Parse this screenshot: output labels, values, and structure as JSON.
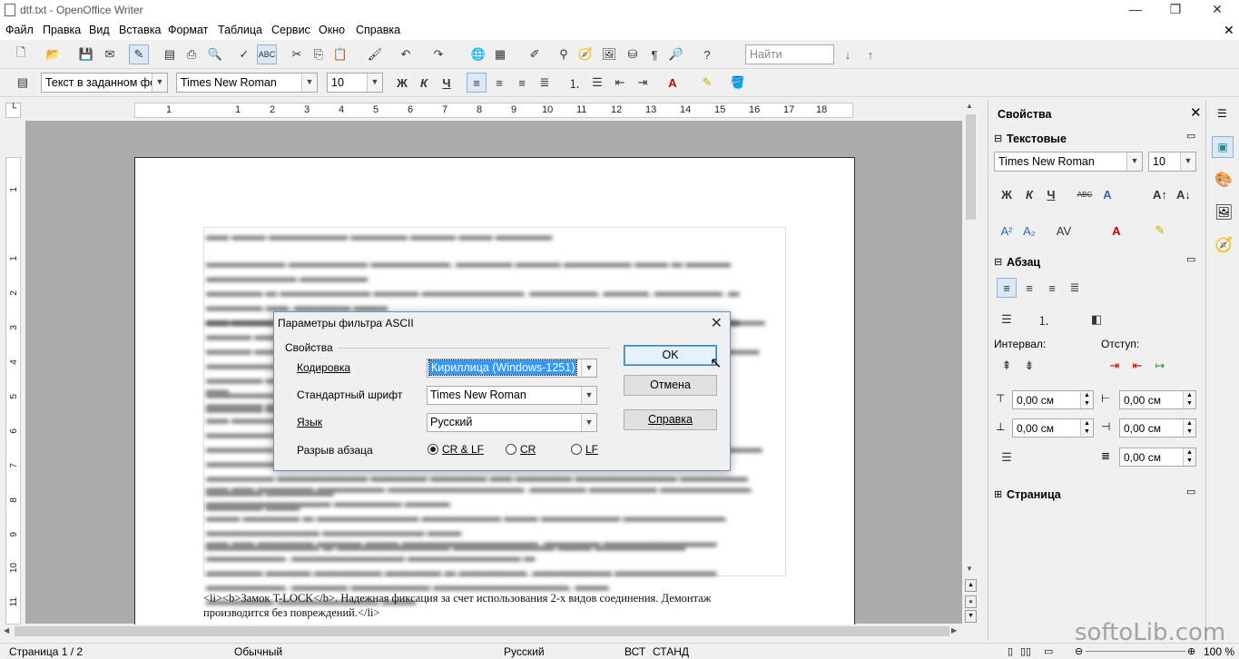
{
  "window": {
    "title": "dtf.txt - OpenOffice Writer",
    "min": "—",
    "restore": "❐",
    "close": "✕"
  },
  "menu": [
    "Файл",
    "Правка",
    "Вид",
    "Вставка",
    "Формат",
    "Таблица",
    "Сервис",
    "Окно",
    "Справка"
  ],
  "menu_close": "✕",
  "toolbar1": {
    "find_placeholder": "Найти"
  },
  "toolbar2": {
    "style": "Текст в заданном фор",
    "font": "Times New Roman",
    "size": "10",
    "bold": "Ж",
    "italic": "К",
    "underline": "Ч"
  },
  "ruler": {
    "h_ticks": [
      "1",
      "1",
      "2",
      "3",
      "4",
      "5",
      "6",
      "7",
      "8",
      "9",
      "10",
      "11",
      "12",
      "13",
      "14",
      "15",
      "16",
      "17",
      "18"
    ],
    "v_ticks": [
      "1",
      "1",
      "2",
      "3",
      "4",
      "5",
      "6",
      "7",
      "8",
      "9",
      "10",
      "11"
    ]
  },
  "document": {
    "clear_line1": "<li><b>Замок T-LOCK</b>. Надежная фиксация за счет использования 2-х видов соединения. Демонтаж",
    "clear_line2": "производится без повреждений.</li>"
  },
  "dialog": {
    "title": "Параметры фильтра ASCII",
    "group": "Свойства",
    "encoding_label": "Кодировка",
    "encoding_value": "Кириллица (Windows-1251)",
    "font_label": "Стандартный шрифт",
    "font_value": "Times New Roman",
    "lang_label": "Язык",
    "lang_value": "Русский",
    "break_label": "Разрыв абзаца",
    "radios": [
      "CR & LF",
      "CR",
      "LF"
    ],
    "selected_radio": "CR & LF",
    "ok": "OK",
    "cancel": "Отмена",
    "help": "Справка"
  },
  "sidebar": {
    "title": "Свойства",
    "text_section": "Текстовые",
    "font": "Times New Roman",
    "size": "10",
    "para_section": "Абзац",
    "interval_label": "Интервал:",
    "indent_label": "Отступ:",
    "spacing_values": [
      "0,00 см",
      "0,00 см",
      "0,00 см",
      "0,00 см",
      "0,00 см"
    ],
    "page_section": "Страница"
  },
  "status": {
    "page": "Страница   1 / 2",
    "style": "Обычный",
    "lang": "Русский",
    "mode1": "ВСТ",
    "mode2": "СТАНД",
    "zoom": "100 %"
  },
  "watermark": "softoLib.com"
}
